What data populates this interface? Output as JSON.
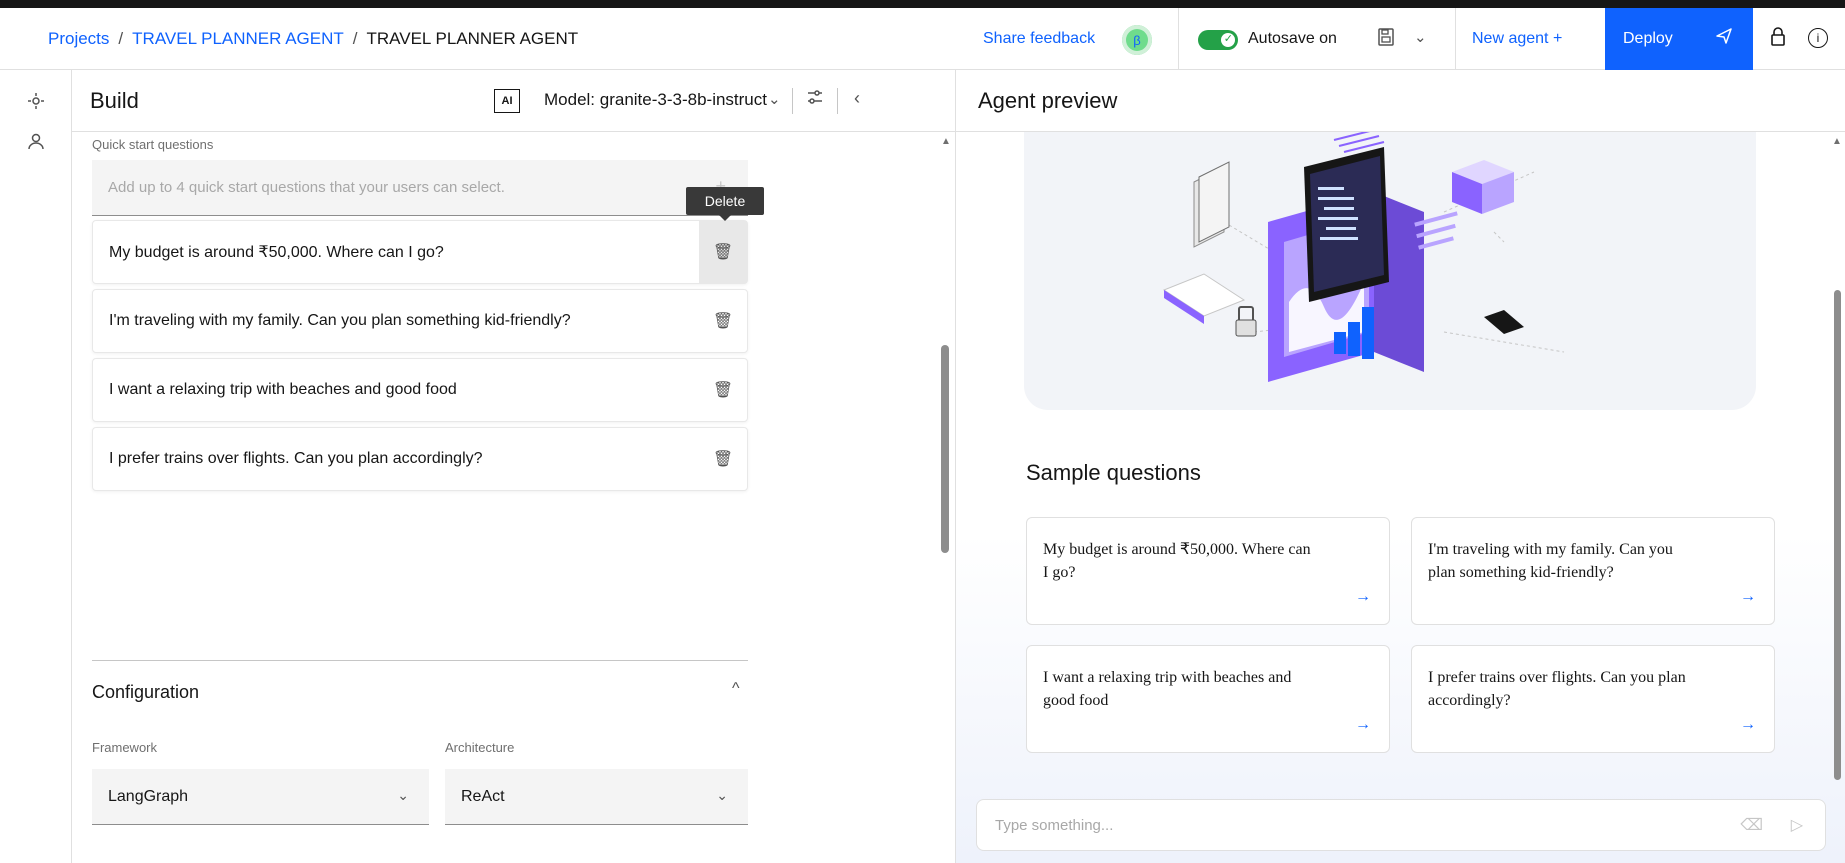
{
  "breadcrumb": {
    "root": "Projects",
    "project": "TRAVEL PLANNER AGENT",
    "current": "TRAVEL PLANNER AGENT",
    "separator": "/"
  },
  "header": {
    "share_feedback": "Share feedback",
    "avatar_initial": "β",
    "autosave_label": "Autosave on",
    "autosave_on": true,
    "new_agent": "New agent +",
    "deploy": "Deploy"
  },
  "build": {
    "title": "Build",
    "ai_badge": "AI",
    "model_label": "Model: granite-3-3-8b-instruct",
    "quick_start": {
      "label": "Quick start questions",
      "placeholder": "Add up to 4 quick start questions that your users can select.",
      "tooltip": "Delete",
      "questions": [
        "My budget is around ₹50,000. Where can I go?",
        "I'm traveling with my family. Can you plan something kid-friendly?",
        "I want a relaxing trip with beaches and good food",
        "I prefer trains over flights. Can you plan accordingly?"
      ]
    },
    "configuration": {
      "title": "Configuration",
      "framework_label": "Framework",
      "framework_value": "LangGraph",
      "architecture_label": "Architecture",
      "architecture_value": "ReAct"
    }
  },
  "preview": {
    "title": "Agent preview",
    "sample_title": "Sample questions",
    "samples": [
      "My budget is around ₹50,000. Where can I go?",
      "I'm traveling with my family. Can you plan something kid-friendly?",
      "I want a relaxing trip with beaches and good food",
      "I prefer trains over flights. Can you plan accordingly?"
    ],
    "input_placeholder": "Type something..."
  },
  "icons": {
    "accent": "#0f62fe",
    "toggle_on": "#24a148",
    "illustration_purple": "#8a63ff"
  }
}
